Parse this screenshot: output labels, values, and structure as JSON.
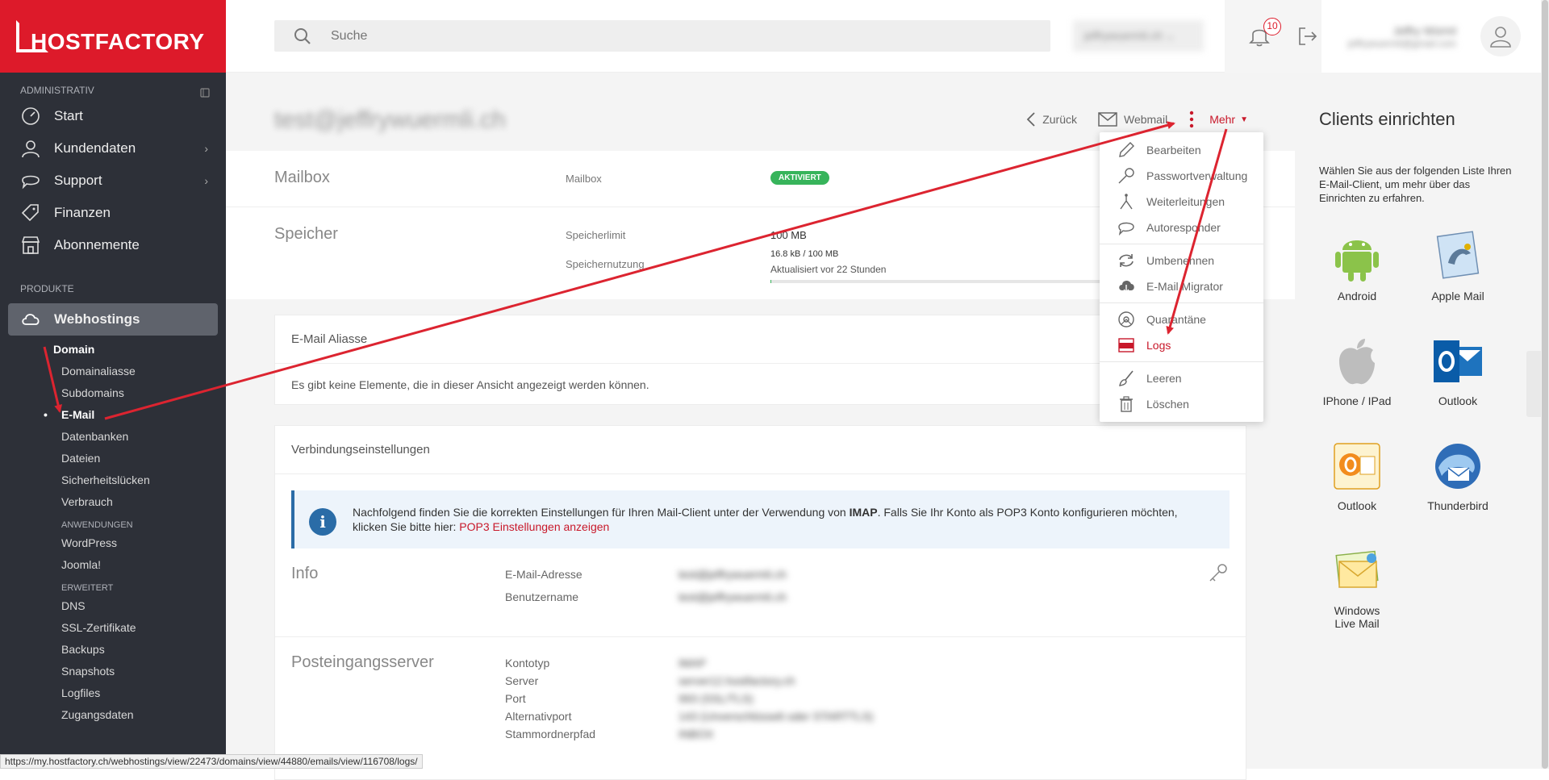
{
  "brand": {
    "name": "HOSTFACTORY"
  },
  "search": {
    "placeholder": "Suche"
  },
  "topbar": {
    "account_select": "jeffrywuermli.ch",
    "notification_count": "10",
    "user_name": "Jeffry Würml",
    "user_email": "jeffrywuermli@gmail.com"
  },
  "sidebar": {
    "section_admin": "ADMINISTRATIV",
    "items": [
      {
        "label": "Start",
        "icon": "speedometer-icon"
      },
      {
        "label": "Kundendaten",
        "icon": "user-icon"
      },
      {
        "label": "Support",
        "icon": "chat-icon"
      },
      {
        "label": "Finanzen",
        "icon": "tag-icon"
      },
      {
        "label": "Abonnemente",
        "icon": "store-icon"
      }
    ],
    "section_products": "PRODUKTE",
    "webhostings": "Webhostings",
    "domain": "Domain",
    "domain_subitems": [
      "Domainaliasse",
      "Subdomains",
      "E-Mail",
      "Datenbanken",
      "Dateien",
      "Sicherheitslücken",
      "Verbrauch"
    ],
    "section_apps": "ANWENDUNGEN",
    "apps": [
      "WordPress",
      "Joomla!"
    ],
    "section_extended": "ERWEITERT",
    "extended": [
      "DNS",
      "SSL-Zertifikate",
      "Backups",
      "Snapshots",
      "Logfiles",
      "Zugangsdaten"
    ]
  },
  "page": {
    "title": "test@jeffrywuermli.ch",
    "back": "Zurück",
    "webmail": "Webmail",
    "more": "Mehr"
  },
  "mailbox": {
    "section": "Mailbox",
    "label": "Mailbox",
    "status": "AKTIVIERT"
  },
  "storage": {
    "section": "Speicher",
    "limit_label": "Speicherlimit",
    "limit_value": "100 MB",
    "usage_label": "Speichernutzung",
    "usage_value": "16.8 kB / 100 MB",
    "usage_fraction": 0.000168,
    "updated": "Aktualisiert vor 22 Stunden"
  },
  "aliases": {
    "title": "E-Mail Aliasse",
    "empty": "Es gibt keine Elemente, die in dieser Ansicht angezeigt werden können."
  },
  "connection": {
    "title": "Verbindungseinstellungen",
    "info_pre": "Nachfolgend finden Sie die korrekten Einstellungen für Ihren Mail-Client unter der Verwendung von ",
    "info_bold": "IMAP",
    "info_post": ". Falls Sie Ihr Konto als POP3 Konto konfigurieren möchten, klicken Sie bitte hier: ",
    "info_link": "POP3 Einstellungen anzeigen",
    "info_section": "Info",
    "email_label": "E-Mail-Adresse",
    "email_value": "test@jeffrywuermli.ch",
    "user_label": "Benutzername",
    "user_value": "test@jeffrywuermli.ch",
    "incoming_section": "Posteingangsserver",
    "type_label": "Kontotyp",
    "type_value": "IMAP",
    "server_label": "Server",
    "server_value": "server12.hostfactory.ch",
    "port_label": "Port",
    "port_value": "993 (SSL/TLS)",
    "altport_label": "Alternativport",
    "altport_value": "143 (Unverschlüsselt oder STARTTLS)",
    "root_label": "Stammordnerpfad",
    "root_value": "INBOX"
  },
  "dropdown": [
    {
      "label": "Bearbeiten",
      "icon": "pencil-icon"
    },
    {
      "label": "Passwortverwaltung",
      "icon": "key-icon"
    },
    {
      "label": "Weiterleitungen",
      "icon": "fork-icon"
    },
    {
      "label": "Autoresponder",
      "icon": "speech-bubble-icon"
    },
    {
      "label": "Umbenennen",
      "icon": "refresh-icon"
    },
    {
      "label": "E-Mail Migrator",
      "icon": "cloud-icon"
    },
    {
      "label": "Quarantäne",
      "icon": "biohazard-icon"
    },
    {
      "label": "Logs",
      "icon": "log-icon"
    },
    {
      "label": "Leeren",
      "icon": "broom-icon"
    },
    {
      "label": "Löschen",
      "icon": "trash-icon"
    }
  ],
  "clients": {
    "title": "Clients einrichten",
    "description": "Wählen Sie aus der folgenden Liste Ihren E-Mail-Client, um mehr über das Einrichten zu erfahren.",
    "items": [
      "Android",
      "Apple Mail",
      "IPhone / IPad",
      "Outlook",
      "Outlook",
      "Thunderbird",
      "Windows Live Mail"
    ]
  },
  "statusbar": {
    "url": "https://my.hostfactory.ch/webhostings/view/22473/domains/view/44880/emails/view/116708/logs/"
  },
  "colors": {
    "brand_red": "#dd1a2a",
    "sidebar_bg": "#2d3038",
    "success_green": "#37b45b",
    "info_blue": "#2a6ca7"
  }
}
